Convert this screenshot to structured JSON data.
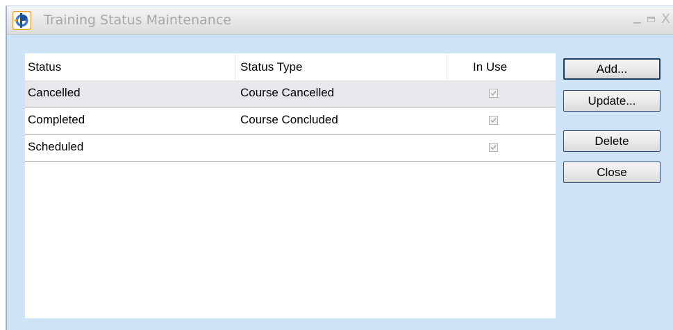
{
  "window": {
    "title": "Training Status Maintenance",
    "icon": "app-logo-icon",
    "controls": {
      "minimize": "minimize-icon",
      "maximize": "maximize-icon",
      "close_glyph": "X"
    }
  },
  "table": {
    "columns": [
      "Status",
      "Status Type",
      "In Use"
    ],
    "rows": [
      {
        "status": "Cancelled",
        "status_type": "Course Cancelled",
        "in_use": true
      },
      {
        "status": "Completed",
        "status_type": "Course Concluded",
        "in_use": true
      },
      {
        "status": "Scheduled",
        "status_type": "",
        "in_use": true
      }
    ],
    "selected_row": 0
  },
  "buttons": {
    "add": "Add...",
    "update": "Update...",
    "delete": "Delete",
    "close": "Close"
  },
  "colors": {
    "window_bg": "#cfe3f7",
    "button_border": "#1d3c66",
    "selected_row_bg": "#e8e7eb"
  }
}
